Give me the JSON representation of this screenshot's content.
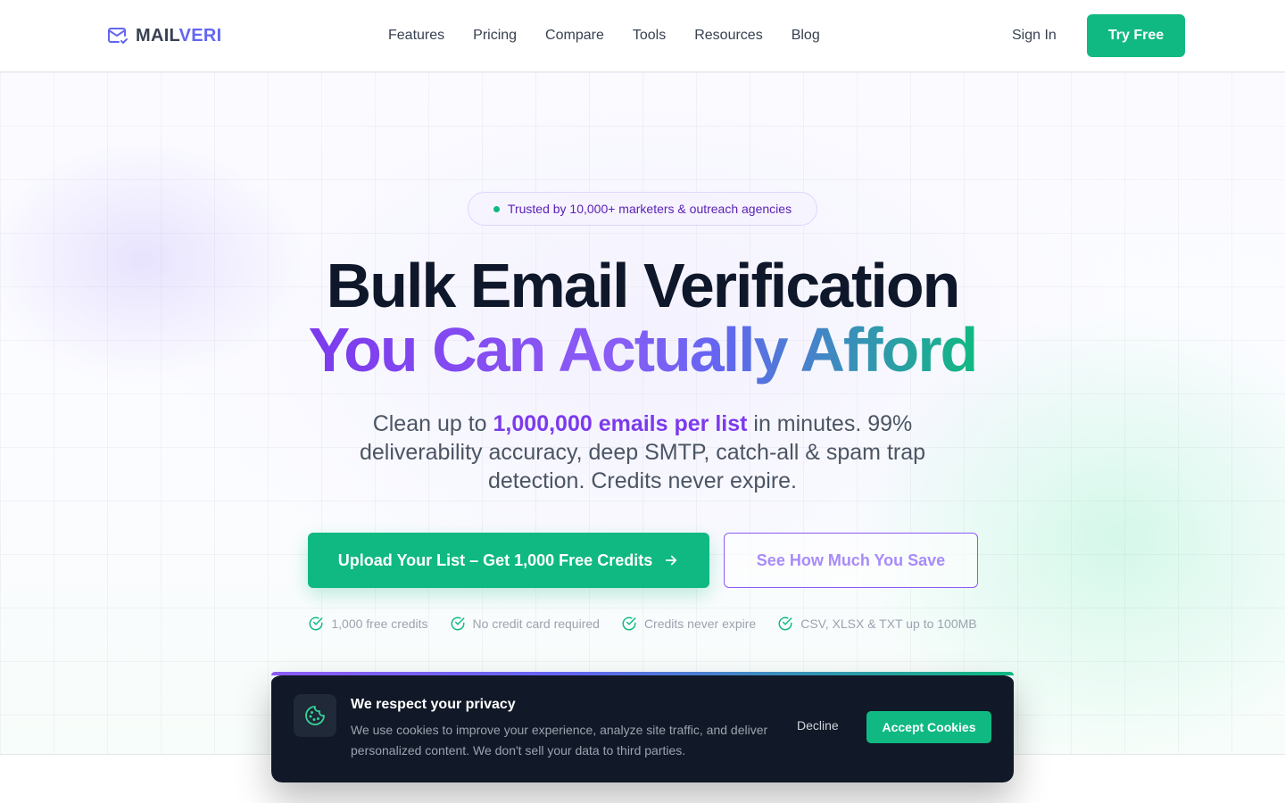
{
  "header": {
    "logo": {
      "part1": "MAIL",
      "part2": "VERI",
      "icon": "mail-check-icon"
    },
    "nav": [
      "Features",
      "Pricing",
      "Compare",
      "Tools",
      "Resources",
      "Blog"
    ],
    "sign_in": "Sign In",
    "try_free": "Try Free"
  },
  "hero": {
    "trust_badge": "Trusted by 10,000+ marketers & outreach agencies",
    "headline_line1": "Bulk Email Verification",
    "headline_line2": "You Can Actually Afford",
    "subtext_before": "Clean up to ",
    "subtext_highlight": "1,000,000 emails per list",
    "subtext_after": " in minutes. 99% deliverability accuracy, deep SMTP, catch-all & spam trap detection. Credits never expire.",
    "primary_cta": "Upload Your List – Get 1,000 Free Credits",
    "secondary_cta": "See How Much You Save",
    "features": [
      "1,000 free credits",
      "No credit card required",
      "Credits never expire",
      "CSV, XLSX & TXT up to 100MB"
    ]
  },
  "cookie_banner": {
    "icon": "cookie-icon",
    "title": "We respect your privacy",
    "body": "We use cookies to improve your experience, analyze site traffic, and deliver personalized content. We don't sell your data to third parties.",
    "decline": "Decline",
    "accept": "Accept Cookies"
  },
  "colors": {
    "brand_green": "#10b981",
    "brand_purple": "#7c3aed",
    "dark_navy": "#111827"
  }
}
